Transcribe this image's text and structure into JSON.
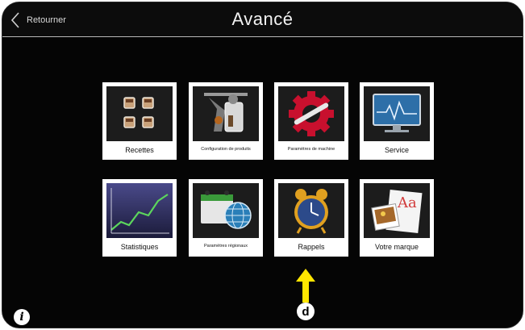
{
  "header": {
    "back_label": "Retourner",
    "title": "Avancé"
  },
  "tiles": [
    {
      "label": "Recettes",
      "icon": "recipes-cups-icon"
    },
    {
      "label": "Configuration de produits",
      "icon": "product-config-icon"
    },
    {
      "label": "Paramètres de machine",
      "icon": "machine-settings-icon"
    },
    {
      "label": "Service",
      "icon": "service-monitor-icon"
    },
    {
      "label": "Statistiques",
      "icon": "statistics-chart-icon"
    },
    {
      "label": "Paramètres régionaux",
      "icon": "regional-settings-icon"
    },
    {
      "label": "Rappels",
      "icon": "alarm-clock-icon"
    },
    {
      "label": "Votre marque",
      "icon": "brand-icon"
    }
  ],
  "annotation": {
    "marker": "d",
    "arrow_color": "#ffe600"
  },
  "info_label": "i"
}
